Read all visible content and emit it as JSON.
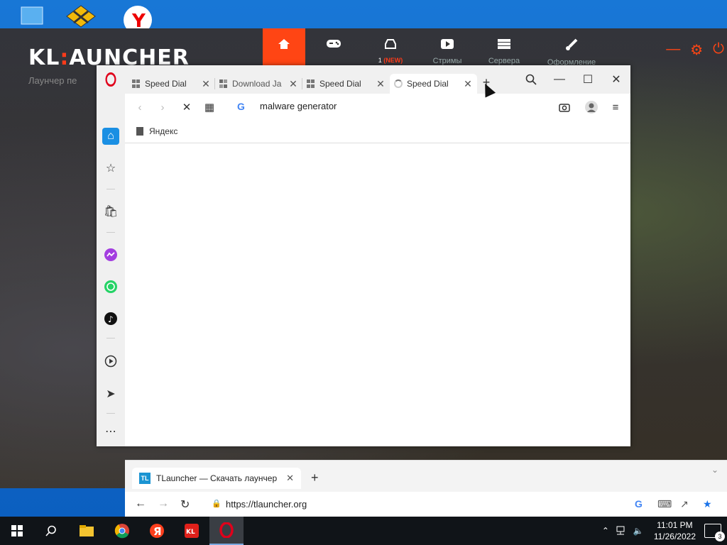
{
  "kl_launcher": {
    "logo_left": "KL",
    "logo_colon": ":",
    "logo_right": "AUNCHER",
    "subtitle": "Лаунчер пе",
    "nav": [
      {
        "label": "",
        "icon": "home-icon",
        "active": true
      },
      {
        "label": "",
        "icon": "gamepad-icon",
        "active": false
      },
      {
        "label": "1",
        "badge": "(NEW)",
        "icon": "inbox-icon",
        "active": false
      },
      {
        "label": "Стримы",
        "icon": "play-icon",
        "active": false
      },
      {
        "label": "Сервера",
        "icon": "servers-icon",
        "active": false
      },
      {
        "label": "Оформление",
        "icon": "brush-icon",
        "active": false
      }
    ]
  },
  "opera": {
    "tabs": [
      {
        "label": "Speed Dial",
        "icon": "speed-dial-icon",
        "active": false
      },
      {
        "label": "Download Ja",
        "icon": "java-icon",
        "active": false
      },
      {
        "label": "Speed Dial",
        "icon": "speed-dial-icon",
        "active": false
      },
      {
        "label": "Speed Dial",
        "icon": "loading-spinner-icon",
        "active": true
      }
    ],
    "address": "malware generator",
    "bookmarks": [
      {
        "label": "Яндекс"
      }
    ]
  },
  "edge": {
    "tab_title": "TLauncher — Скачать лаунчер",
    "tab_badge": "TL",
    "url": "https://tlauncher.org"
  },
  "taskbar": {
    "time": "11:01 PM",
    "date": "11/26/2022",
    "notification_count": "3",
    "apps": [
      "file-explorer-icon",
      "chrome-icon",
      "yandex-icon",
      "kl-launcher-icon",
      "opera-icon"
    ]
  },
  "colors": {
    "accent_red": "#ff4514",
    "opera_red": "#e0001b",
    "desktop_blue": "#0b5fc0"
  }
}
